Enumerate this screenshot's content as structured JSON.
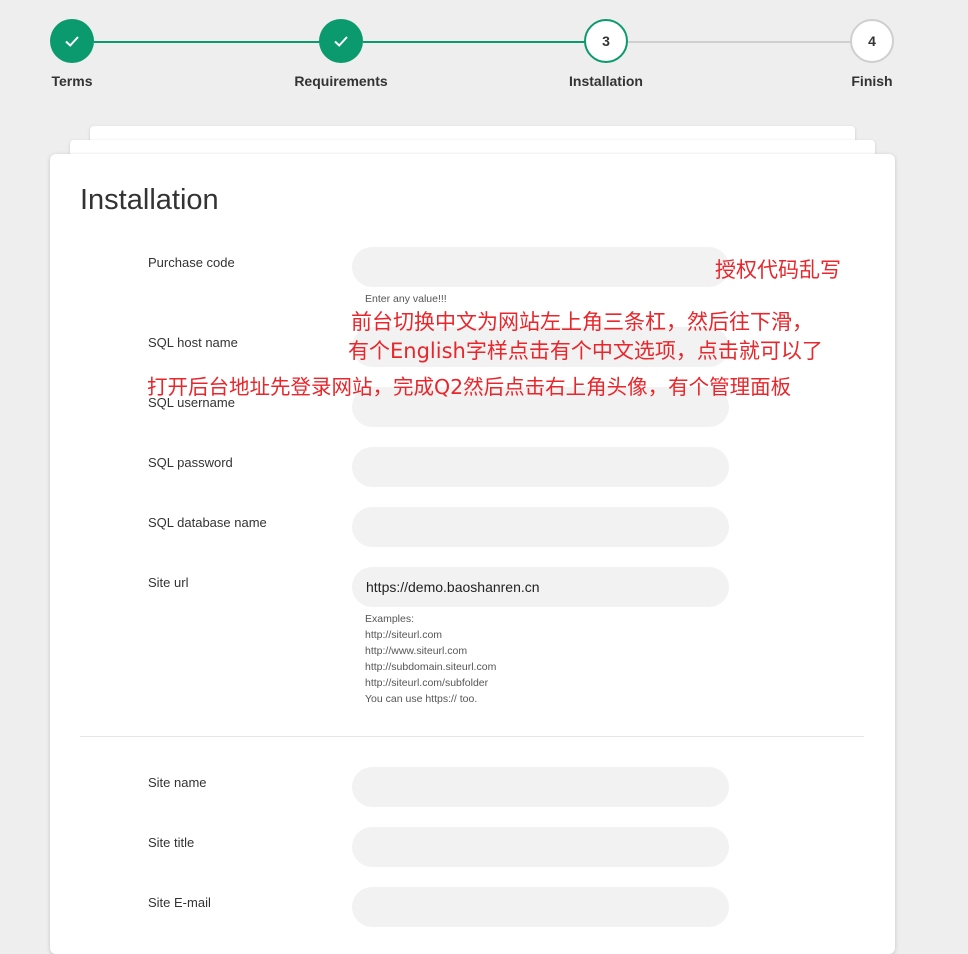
{
  "stepper": {
    "steps": [
      {
        "label": "Terms",
        "state": "done",
        "number": ""
      },
      {
        "label": "Requirements",
        "state": "done",
        "number": ""
      },
      {
        "label": "Installation",
        "state": "active",
        "number": "3"
      },
      {
        "label": "Finish",
        "state": "todo",
        "number": "4"
      }
    ],
    "accent_color": "#0b9a6d"
  },
  "form": {
    "title": "Installation",
    "purchase_code": {
      "label": "Purchase code",
      "value": "",
      "help": "Enter any value!!!"
    },
    "sql_host": {
      "label": "SQL host name",
      "value": ""
    },
    "sql_username": {
      "label": "SQL username",
      "value": ""
    },
    "sql_password": {
      "label": "SQL password",
      "value": ""
    },
    "sql_database": {
      "label": "SQL database name",
      "value": ""
    },
    "site_url": {
      "label": "Site url",
      "value": "https://demo.baoshanren.cn",
      "help": [
        "Examples:",
        "http://siteurl.com",
        "http://www.siteurl.com",
        "http://subdomain.siteurl.com",
        "http://siteurl.com/subfolder",
        "You can use https:// too."
      ]
    },
    "site_name": {
      "label": "Site name",
      "value": ""
    },
    "site_title": {
      "label": "Site title",
      "value": ""
    },
    "site_email": {
      "label": "Site E-mail",
      "value": ""
    }
  },
  "annotations": {
    "note1": "授权代码乱写",
    "note2": "前台切换中文为网站左上角三条杠，然后往下滑，",
    "note3": "有个English字样点击有个中文选项，点击就可以了",
    "note4": "打开后台地址先登录网站，完成Q2然后点击右上角头像，有个管理面板",
    "color": "#e8262b"
  }
}
